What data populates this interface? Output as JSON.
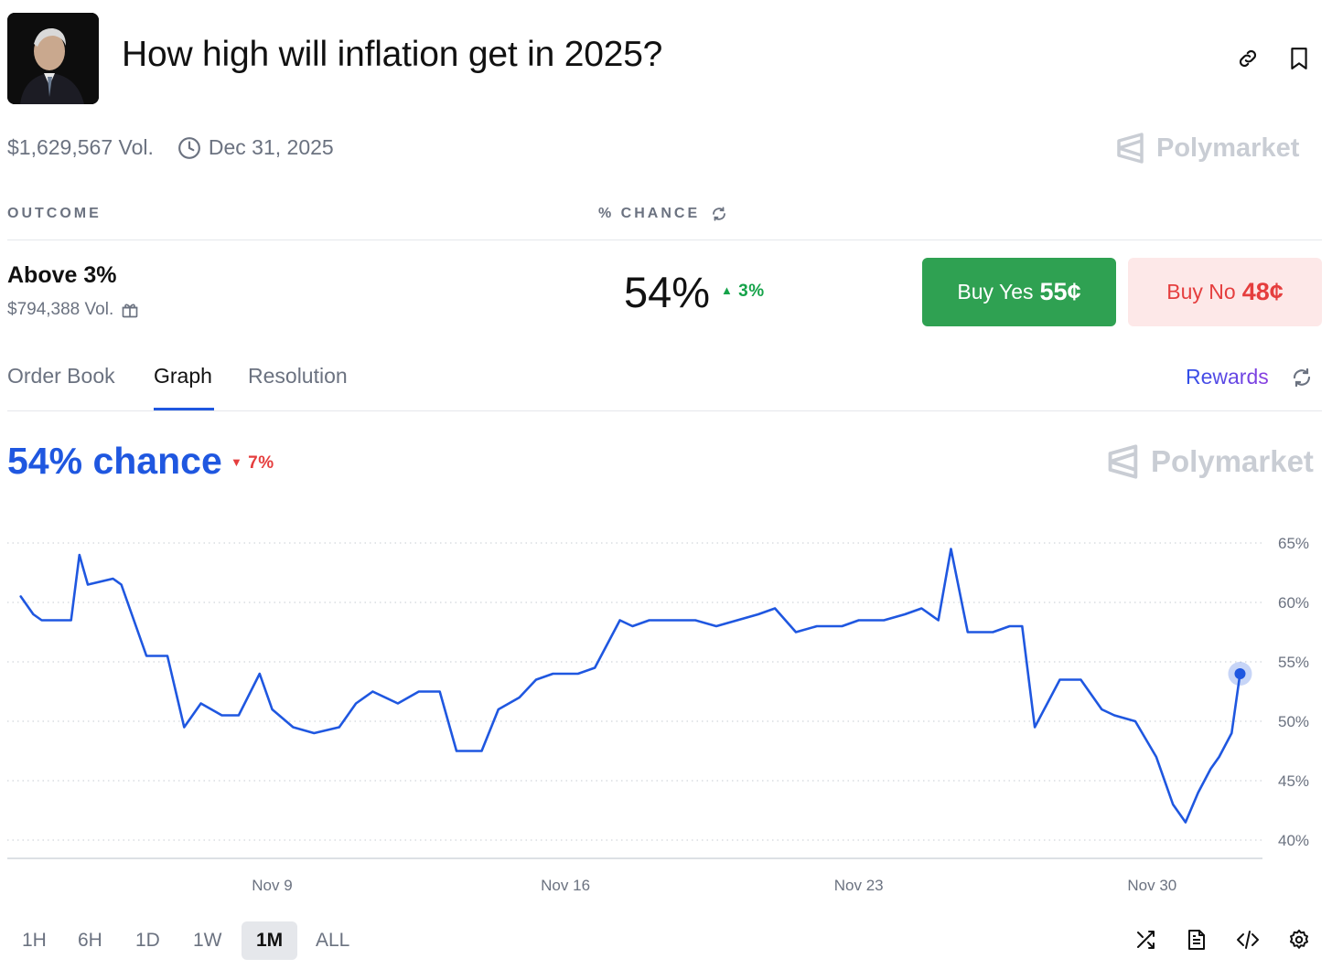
{
  "header": {
    "title": "How high will inflation get in 2025?",
    "volume": "$1,629,567 Vol.",
    "end_date": "Dec 31, 2025",
    "brand": "Polymarket"
  },
  "columns": {
    "outcome": "OUTCOME",
    "chance": "% CHANCE"
  },
  "outcome": {
    "name": "Above 3%",
    "volume": "$794,388 Vol.",
    "chance": "54%",
    "change": "3%",
    "buy_yes_label": "Buy Yes",
    "buy_yes_price": "55¢",
    "buy_no_label": "Buy No",
    "buy_no_price": "48¢"
  },
  "tabs": [
    "Order Book",
    "Graph",
    "Resolution"
  ],
  "active_tab": "Graph",
  "rewards_label": "Rewards",
  "graph": {
    "chance_text": "54% chance",
    "change": "7%",
    "brand": "Polymarket"
  },
  "ranges": [
    "1H",
    "6H",
    "1D",
    "1W",
    "1M",
    "ALL"
  ],
  "active_range": "1M",
  "colors": {
    "line": "#1f57e0",
    "up": "#16a34a",
    "down": "#e53e3e",
    "yes": "#2fa152",
    "no_bg": "#fde8e8"
  },
  "icons": [
    "link-icon",
    "bookmark-icon",
    "clock-icon",
    "gift-icon",
    "refresh-icon",
    "shuffle-icon",
    "document-icon",
    "code-icon",
    "settings-icon"
  ],
  "chart_data": {
    "type": "line",
    "series": [
      {
        "x": [
          "Nov 3",
          "Nov 3.3",
          "Nov 3.5",
          "Nov 4.2",
          "Nov 4.4",
          "Nov 4.6",
          "Nov 5.2",
          "Nov 5.4",
          "Nov 6",
          "Nov 6.5",
          "Nov 6.9",
          "Nov 7.3",
          "Nov 7.8",
          "Nov 8.2",
          "Nov 8.7",
          "Nov 9",
          "Nov 9.5",
          "Nov 10",
          "Nov 10.6",
          "Nov 11",
          "Nov 11.4",
          "Nov 12",
          "Nov 12.5",
          "Nov 13",
          "Nov 13.4",
          "Nov 14",
          "Nov 14.4",
          "Nov 14.9",
          "Nov 15.3",
          "Nov 15.7",
          "Nov 16.3",
          "Nov 16.7",
          "Nov 17.3",
          "Nov 17.6",
          "Nov 18",
          "Nov 18.6",
          "Nov 19.1",
          "Nov 19.6",
          "Nov 20.1",
          "Nov 20.6",
          "Nov 21",
          "Nov 21.5",
          "Nov 22",
          "Nov 22.6",
          "Nov 23",
          "Nov 23.6",
          "Nov 24.1",
          "Nov 24.5",
          "Nov 24.9",
          "Nov 25.2",
          "Nov 25.6",
          "Nov 26.2",
          "Nov 26.6",
          "Nov 26.9",
          "Nov 27.2",
          "Nov 27.5",
          "Nov 27.8",
          "Nov 28.3",
          "Nov 28.8",
          "Nov 29.1",
          "Nov 29.6",
          "Nov 30.1",
          "Nov 30.5",
          "Nov 30.8",
          "Dec 1.1",
          "Dec 1.4",
          "Dec 1.6",
          "Dec 1.9",
          "Dec 2.1"
        ],
        "y": [
          60.5,
          59,
          58.5,
          58.5,
          64,
          61.5,
          62,
          61.5,
          55.5,
          55.5,
          49.5,
          51.5,
          50.5,
          50.5,
          54,
          51,
          49.5,
          49,
          49.5,
          51.5,
          52.5,
          51.5,
          52.5,
          52.5,
          47.5,
          47.5,
          51,
          52,
          53.5,
          54,
          54,
          54.5,
          58.5,
          58,
          58.5,
          58.5,
          58.5,
          58,
          58.5,
          59,
          59.5,
          57.5,
          58,
          58,
          58.5,
          58.5,
          59,
          59.5,
          58.5,
          64.5,
          57.5,
          57.5,
          58,
          58,
          49.5,
          51.5,
          53.5,
          53.5,
          51,
          50.5,
          50,
          47,
          43,
          41.5,
          44,
          46,
          47,
          49,
          54
        ]
      }
    ],
    "xticks": [
      "Nov 9",
      "Nov 16",
      "Nov 23",
      "Nov 30"
    ],
    "yticks": [
      "40%",
      "45%",
      "50%",
      "55%",
      "60%",
      "65%"
    ],
    "ylim": [
      40,
      65
    ],
    "grid": true
  }
}
